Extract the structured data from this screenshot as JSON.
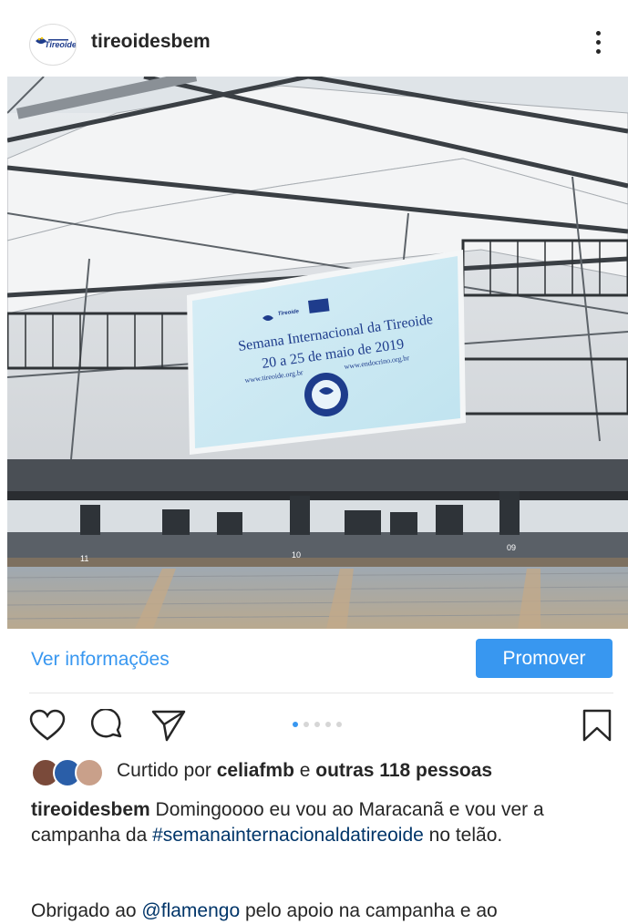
{
  "post": {
    "username": "tireoidesbem",
    "avatar_logo_text": "Tireoide"
  },
  "image": {
    "screen_title_line1": "Semana Internacional da Tireoide",
    "screen_title_line2": "20 a 25 de maio de 2019",
    "screen_url_left": "www.tireoide.org.br",
    "screen_url_right": "www.endocrino.org.br",
    "screen_logo_text": "Tireoide",
    "section_10": "10",
    "section_09": "09",
    "section_11": "11"
  },
  "actions": {
    "ver_informacoes": "Ver informações",
    "promover": "Promover"
  },
  "carousel": {
    "count": 5,
    "active_index": 0
  },
  "likes": {
    "prefix": "Curtido por ",
    "user": "celiafmb",
    "middle": " e ",
    "others": "outras 118 pessoas"
  },
  "caption": {
    "username": "tireoidesbem",
    "text_before": " Domingoooo eu vou ao Maracanã e vou ver a campanha da ",
    "hashtag": "#semanainternacionaldatireoide",
    "text_after": " no telão.",
    "line2_before": "Obrigado ao ",
    "mention": "@flamengo",
    "line2_after": " pelo apoio na campanha e ao"
  },
  "colors": {
    "accent": "#3897f0",
    "text": "#262626",
    "link": "#003569"
  }
}
